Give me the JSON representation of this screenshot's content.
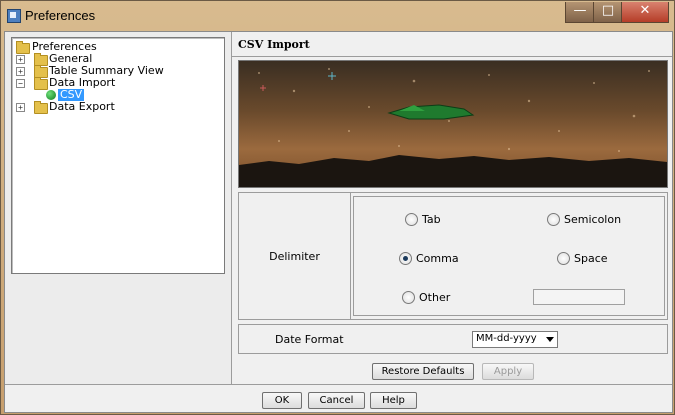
{
  "window": {
    "title": "Preferences",
    "controls": {
      "minimize": "—",
      "maximize": "□",
      "close": "✕"
    }
  },
  "tree": {
    "root": "Preferences",
    "items": [
      {
        "label": "General"
      },
      {
        "label": "Table Summary View"
      },
      {
        "label": "Data Import",
        "children": [
          {
            "label": "CSV",
            "selected": true
          }
        ]
      },
      {
        "label": "Data Export"
      }
    ]
  },
  "panel": {
    "title": "CSV Import",
    "delimiter": {
      "label": "Delimiter",
      "options": [
        {
          "label": "Tab",
          "checked": false
        },
        {
          "label": "Semicolon",
          "checked": false
        },
        {
          "label": "Comma",
          "checked": true
        },
        {
          "label": "Space",
          "checked": false
        },
        {
          "label": "Other",
          "checked": false
        }
      ],
      "other_value": ""
    },
    "date_format": {
      "label": "Date Format",
      "value": "MM-dd-yyyy"
    },
    "restore_label": "Restore Defaults",
    "apply_label": "Apply"
  },
  "footer": {
    "ok": "OK",
    "cancel": "Cancel",
    "help": "Help"
  },
  "colors": {
    "selection": "#3399ff",
    "frame": "#c79f6e"
  }
}
